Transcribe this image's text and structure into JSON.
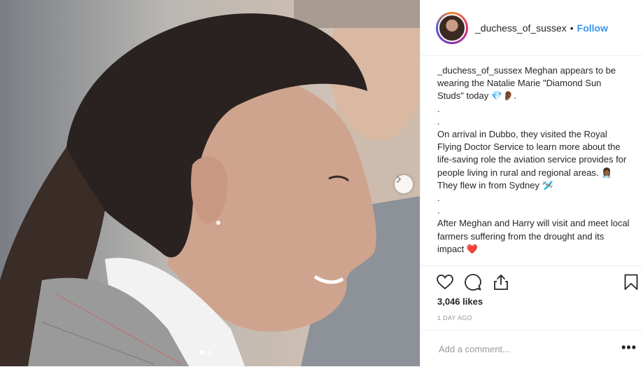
{
  "post": {
    "username": "_duchess_of_sussex",
    "separator": "•",
    "follow_label": "Follow",
    "caption": {
      "username": "_duchess_of_sussex",
      "text_1": "Meghan appears to be wearing the Natalie Marie \"Diamond Sun Studs\" today 💎👂🏾.",
      "dot_1": ".",
      "dot_2": ".",
      "text_2": "On arrival in Dubbo, they visited the Royal Flying Doctor Service to learn more about the life-saving role the aviation service provides for people living in rural and regional areas. 👩🏾‍⚕️ They flew in from Sydney 🛩️",
      "dot_3": ".",
      "dot_4": ".",
      "text_3": "After Meghan and Harry will visit and meet local farmers suffering from the drought and its impact ❤️"
    },
    "likes": "3,046 likes",
    "date": "1 DAY AGO",
    "comment_placeholder": "Add a comment...",
    "more_label": "•••",
    "carousel": {
      "slide_count": 2,
      "active_slide": 1
    }
  },
  "icons": {
    "like": "heart-icon",
    "comment": "comment-icon",
    "share": "share-icon",
    "save": "bookmark-icon",
    "next": "chevron-right-icon"
  },
  "colors": {
    "follow": "#3897f0",
    "text": "#262626",
    "muted": "#999999",
    "border": "#efefef"
  }
}
